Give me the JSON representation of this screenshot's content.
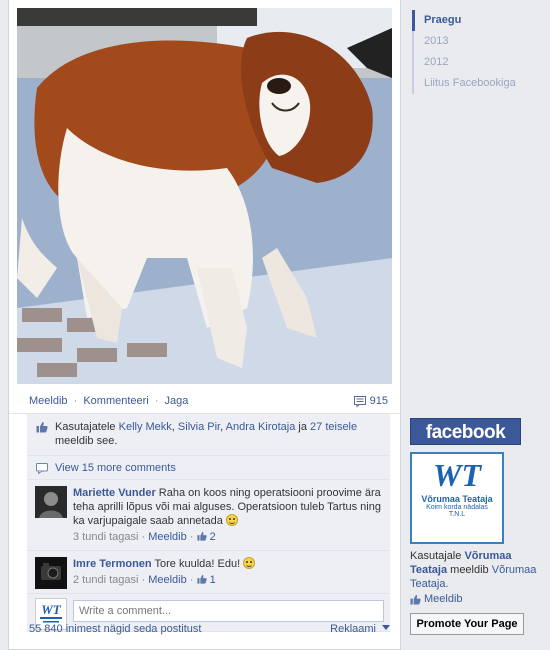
{
  "story": {
    "actions": {
      "like": "Meeldib",
      "comment": "Kommenteeri",
      "share": "Jaga",
      "separator": "·",
      "comment_count": "915"
    },
    "likes": {
      "prefix": "Kasutajatele",
      "names": [
        "Kelly Mekk",
        "Silvia Pir",
        "Andra Kirotaja"
      ],
      "conjunction": "ja",
      "others": "27 teisele",
      "suffix": "meeldib see."
    },
    "view_more": "View 15 more comments",
    "comments": [
      {
        "author": "Mariette Vunder",
        "text": "Raha on koos ning operatsiooni proovime ära teha aprilli lõpus või mai alguses. Operatsioon tuleb Tartus ning ka varjupaigale saab annetada",
        "time": "3 tundi tagasi",
        "like_label": "Meeldib",
        "like_count": "2"
      },
      {
        "author": "Imre Termonen",
        "text": "Tore kuulda! Edu!",
        "time": "2 tundi tagasi",
        "like_label": "Meeldib",
        "like_count": "1"
      }
    ],
    "write_placeholder": "Write a comment...",
    "seen": "55 840 inimest nägid seda postitust",
    "ads_label": "Reklaami"
  },
  "timeline": [
    "Praegu",
    "2013",
    "2012",
    "Liitus Facebookiga"
  ],
  "fb_box": {
    "header": "facebook",
    "logo": {
      "letters": "WT",
      "name": "Võrumaa Teataja",
      "tagline": "Koim korda nädalas",
      "sub": "T.N.L"
    },
    "line_prefix": "Kasutajale",
    "page_name": "Võrumaa Teataja",
    "line_suffix": "meeldib",
    "page_link": "Võrumaa Teataja.",
    "like_label": "Meeldib",
    "promote_label": "Promote Your Page"
  },
  "colors": {
    "fb_blue": "#3b5998",
    "ufi_bg": "#edeff4",
    "page_bg": "#e9ebee"
  }
}
